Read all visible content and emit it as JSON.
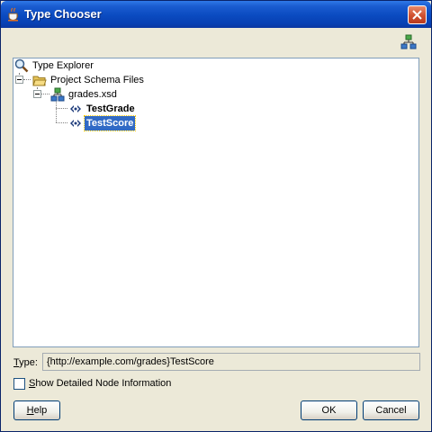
{
  "window": {
    "title": "Type Chooser",
    "icons": [
      "java-cup-icon",
      "close-icon"
    ]
  },
  "toolbar": {
    "icon": "show-hierarchy-icon"
  },
  "tree": {
    "root": {
      "label": "Type Explorer",
      "icon": "magnifier-icon"
    },
    "folder": {
      "label": "Project Schema Files",
      "icon": "open-folder-icon",
      "expanded": true
    },
    "schema": {
      "label": "grades.xsd",
      "icon": "schema-icon",
      "expanded": true
    },
    "types": [
      {
        "label": "TestGrade",
        "icon": "complex-type-icon",
        "selected": false
      },
      {
        "label": "TestScore",
        "icon": "complex-type-icon",
        "selected": true
      }
    ]
  },
  "type_field": {
    "label_mnemonic": "T",
    "label_rest": "ype:",
    "value": "{http://example.com/grades}TestScore"
  },
  "checkbox": {
    "label_mnemonic": "S",
    "label_rest": "how Detailed Node Information",
    "checked": false
  },
  "buttons": {
    "help_mnemonic": "H",
    "help_rest": "elp",
    "ok": "OK",
    "cancel": "Cancel"
  },
  "colors": {
    "title_bar": "#0a4ac0",
    "dialog_bg": "#ece9d8",
    "selection": "#316ac5",
    "close_button": "#d05030"
  }
}
